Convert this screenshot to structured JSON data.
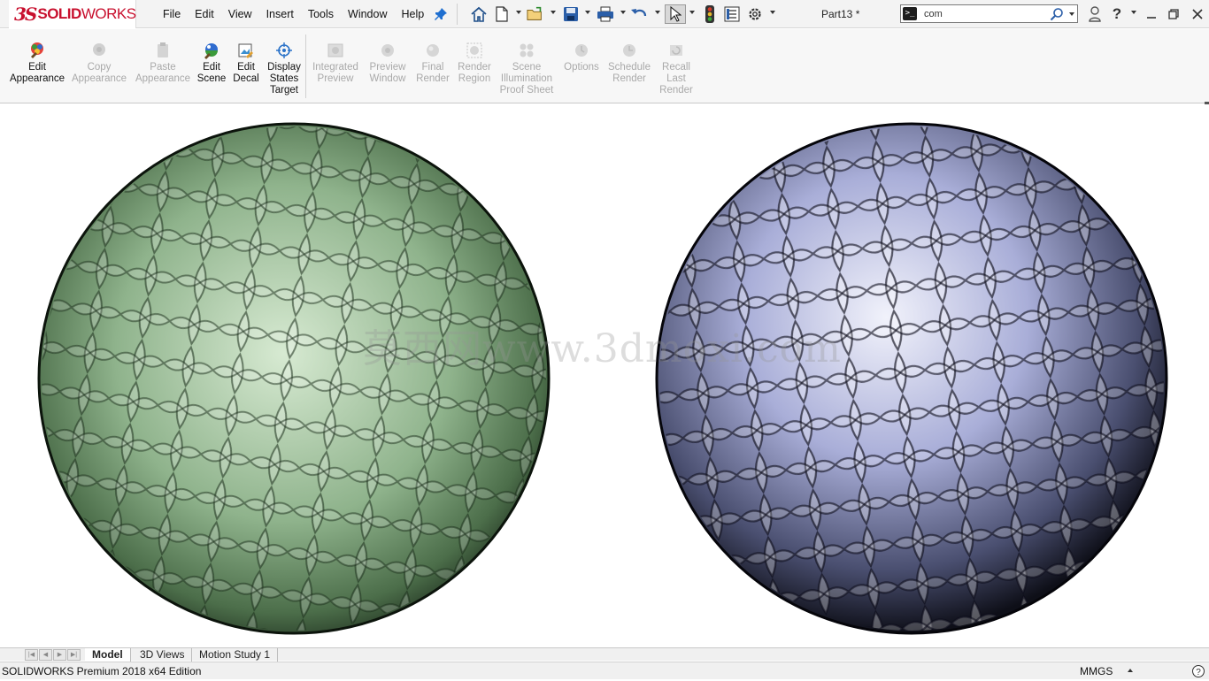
{
  "app": {
    "logo_ds": "3S",
    "logo_solid": "SOLID",
    "logo_works": "WORKS",
    "document_title": "Part13 *"
  },
  "menu": [
    "File",
    "Edit",
    "View",
    "Insert",
    "Tools",
    "Window",
    "Help"
  ],
  "search": {
    "value": "com"
  },
  "command_manager": {
    "tools": [
      {
        "label": "Edit\nAppearance",
        "enabled": true
      },
      {
        "label": "Copy\nAppearance",
        "enabled": false
      },
      {
        "label": "Paste\nAppearance",
        "enabled": false
      },
      {
        "label": "Edit\nScene",
        "enabled": true
      },
      {
        "label": "Edit\nDecal",
        "enabled": true
      },
      {
        "label": "Display\nStates\nTarget",
        "enabled": true
      },
      {
        "label": "Integrated\nPreview",
        "enabled": false
      },
      {
        "label": "Preview\nWindow",
        "enabled": false
      },
      {
        "label": "Final\nRender",
        "enabled": false
      },
      {
        "label": "Render\nRegion",
        "enabled": false
      },
      {
        "label": "Scene\nIllumination\nProof Sheet",
        "enabled": false
      },
      {
        "label": "Options",
        "enabled": false
      },
      {
        "label": "Schedule\nRender",
        "enabled": false
      },
      {
        "label": "Recall\nLast\nRender",
        "enabled": false
      }
    ]
  },
  "viewport": {
    "watermark": "莫西网www.3dmoxi.com",
    "left_sphere_color": "#8fb38c",
    "right_sphere_color": "#a9aed8"
  },
  "tabs": [
    "Model",
    "3D Views",
    "Motion Study 1"
  ],
  "status": {
    "text": "SOLIDWORKS Premium 2018 x64 Edition",
    "units": "MMGS"
  },
  "colors": {
    "brand": "#c8102e",
    "accent": "#1f5fa8"
  }
}
